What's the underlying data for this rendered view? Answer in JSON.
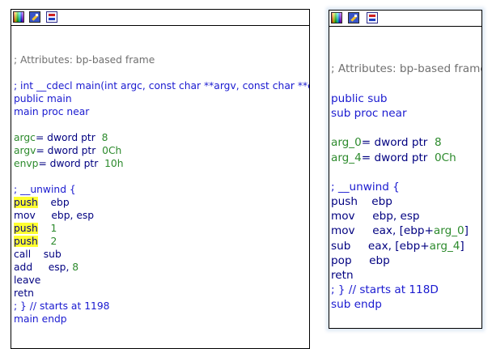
{
  "colors": {
    "comment": "#707070",
    "blue": "#1a1ad0",
    "navy": "#000080",
    "green": "#2c8a2c",
    "highlight": "#ffff30"
  },
  "left": {
    "toolbar": {
      "icons": [
        "palette-icon",
        "edit-icon",
        "graph-icon"
      ]
    },
    "lines": [
      {
        "t": "",
        "c": "c-navy"
      },
      {
        "t": "",
        "c": "c-navy"
      },
      {
        "t": "; Attributes: bp-based frame",
        "c": "c-gray"
      },
      {
        "t": "",
        "c": "c-navy"
      },
      {
        "t": "; int __cdecl main(int argc, const char **argv, const char **envp)",
        "c": "c-blue"
      },
      {
        "t": "public main",
        "c": "c-blue"
      },
      {
        "t": "main proc near",
        "c": "c-blue"
      },
      {
        "t": "",
        "c": "c-navy"
      },
      {
        "parts": [
          {
            "t": "argc",
            "c": "c-green"
          },
          {
            "t": "= dword ptr  ",
            "c": "c-navy"
          },
          {
            "t": "8",
            "c": "c-green"
          }
        ]
      },
      {
        "parts": [
          {
            "t": "argv",
            "c": "c-green"
          },
          {
            "t": "= dword ptr  ",
            "c": "c-navy"
          },
          {
            "t": "0Ch",
            "c": "c-green"
          }
        ]
      },
      {
        "parts": [
          {
            "t": "envp",
            "c": "c-green"
          },
          {
            "t": "= dword ptr  ",
            "c": "c-navy"
          },
          {
            "t": "10h",
            "c": "c-green"
          }
        ]
      },
      {
        "t": "",
        "c": "c-navy"
      },
      {
        "t": "; __unwind {",
        "c": "c-blue"
      },
      {
        "parts": [
          {
            "t": "push",
            "c": "c-navy hl"
          },
          {
            "t": "    ebp",
            "c": "c-navy"
          }
        ]
      },
      {
        "t": "mov     ebp, esp",
        "c": "c-navy"
      },
      {
        "parts": [
          {
            "t": "push",
            "c": "c-navy hl"
          },
          {
            "t": "    ",
            "c": "c-navy"
          },
          {
            "t": "1",
            "c": "c-green"
          }
        ]
      },
      {
        "parts": [
          {
            "t": "push",
            "c": "c-navy hl"
          },
          {
            "t": "    ",
            "c": "c-navy"
          },
          {
            "t": "2",
            "c": "c-green"
          }
        ]
      },
      {
        "t": "call    sub",
        "c": "c-navy"
      },
      {
        "parts": [
          {
            "t": "add     esp, ",
            "c": "c-navy"
          },
          {
            "t": "8",
            "c": "c-green"
          }
        ]
      },
      {
        "t": "leave",
        "c": "c-navy"
      },
      {
        "t": "retn",
        "c": "c-navy"
      },
      {
        "t": "; } // starts at 1198",
        "c": "c-blue"
      },
      {
        "t": "main endp",
        "c": "c-blue"
      }
    ]
  },
  "right": {
    "toolbar": {
      "icons": [
        "palette-icon",
        "edit-icon",
        "graph-icon"
      ]
    },
    "lines": [
      {
        "t": "",
        "c": "c-navy"
      },
      {
        "t": "",
        "c": "c-navy"
      },
      {
        "t": "; Attributes: bp-based frame",
        "c": "c-gray"
      },
      {
        "t": "",
        "c": "c-navy"
      },
      {
        "t": "public sub",
        "c": "c-blue"
      },
      {
        "t": "sub proc near",
        "c": "c-blue"
      },
      {
        "t": "",
        "c": "c-navy"
      },
      {
        "parts": [
          {
            "t": "arg_0",
            "c": "c-green"
          },
          {
            "t": "= dword ptr  ",
            "c": "c-navy"
          },
          {
            "t": "8",
            "c": "c-green"
          }
        ]
      },
      {
        "parts": [
          {
            "t": "arg_4",
            "c": "c-green"
          },
          {
            "t": "= dword ptr  ",
            "c": "c-navy"
          },
          {
            "t": "0Ch",
            "c": "c-green"
          }
        ]
      },
      {
        "t": "",
        "c": "c-navy"
      },
      {
        "t": "; __unwind {",
        "c": "c-blue"
      },
      {
        "t": "push    ebp",
        "c": "c-navy"
      },
      {
        "t": "mov     ebp, esp",
        "c": "c-navy"
      },
      {
        "parts": [
          {
            "t": "mov     eax, [ebp+",
            "c": "c-navy"
          },
          {
            "t": "arg_0",
            "c": "c-green"
          },
          {
            "t": "]",
            "c": "c-navy"
          }
        ]
      },
      {
        "parts": [
          {
            "t": "sub     eax, [ebp+",
            "c": "c-navy"
          },
          {
            "t": "arg_4",
            "c": "c-green"
          },
          {
            "t": "]",
            "c": "c-navy"
          }
        ]
      },
      {
        "t": "pop     ebp",
        "c": "c-navy"
      },
      {
        "t": "retn",
        "c": "c-navy"
      },
      {
        "t": "; } // starts at 118D",
        "c": "c-blue"
      },
      {
        "t": "sub endp",
        "c": "c-blue"
      }
    ]
  }
}
